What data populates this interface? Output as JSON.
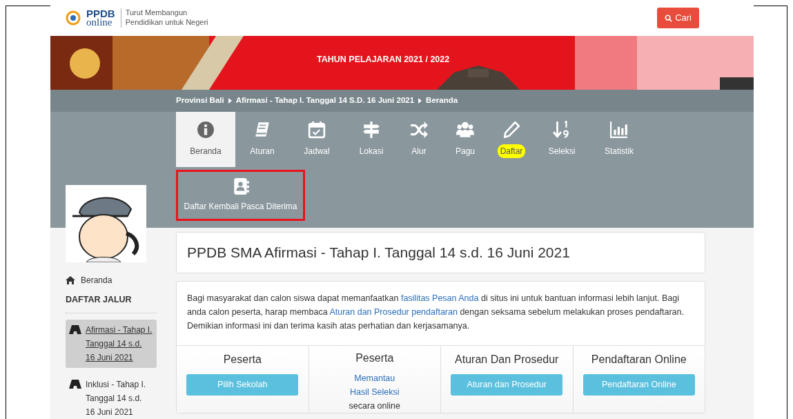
{
  "header": {
    "logo": {
      "top": "PPDB",
      "bottom": "online"
    },
    "tagline": [
      "Turut Membangun",
      "Pendidikan untuk Negeri"
    ],
    "search_button": "Cari"
  },
  "banner": {
    "kind": "picture",
    "title": "TAHUN PELAJARAN 2021 / 2022"
  },
  "breadcrumb": [
    "Provinsi Bali",
    "Afirmasi - Tahap I. Tanggal 14 S.D. 16 Juni 2021",
    "Beranda"
  ],
  "nav": [
    {
      "label": "Beranda",
      "selected": true,
      "marked": false,
      "outlined": false
    },
    {
      "label": "Aturan",
      "selected": false,
      "marked": false,
      "outlined": false
    },
    {
      "label": "Jadwal",
      "selected": false,
      "marked": false,
      "outlined": false
    },
    {
      "label": "Lokasi",
      "selected": false,
      "marked": false,
      "outlined": false
    },
    {
      "label": "Alur",
      "selected": false,
      "marked": false,
      "outlined": false
    },
    {
      "label": "Pagu",
      "selected": false,
      "marked": false,
      "outlined": false
    },
    {
      "label": "Daftar",
      "selected": false,
      "marked": true,
      "outlined": false
    },
    {
      "label": "Seleksi",
      "selected": false,
      "marked": false,
      "outlined": false
    },
    {
      "label": "Statistik",
      "selected": false,
      "marked": false,
      "outlined": false
    },
    {
      "label": "Daftar Kembali Pasca Diterima",
      "selected": false,
      "marked": false,
      "outlined": true
    }
  ],
  "sidebar": {
    "home": "Beranda",
    "heading": "DAFTAR JALUR",
    "items": [
      {
        "label": "Afirmasi - Tahap I. Tanggal 14 s.d. 16 Juni 2021",
        "selected": true
      },
      {
        "label": "Inklusi - Tahap I. Tanggal 14 s.d. 16 Juni 2021",
        "selected": false
      }
    ]
  },
  "page_title": "PPDB SMA Afirmasi - Tahap I. Tanggal 14 s.d. 16 Juni 2021",
  "info": [
    {
      "text": "Bagi masyarakat dan calon siswa dapat memanfaatkan "
    },
    {
      "link": "fasilitas Pesan Anda"
    },
    {
      "text": " di situs ini untuk bantuan informasi lebih lanjut. Bagi anda calon peserta, harap membaca "
    },
    {
      "link": "Aturan dan Prosedur pendaftaran"
    },
    {
      "text": " dengan seksama sebelum melakukan proses pendaftaran. Demikian informasi ini dan terima kasih atas perhatian dan kerjasamanya."
    }
  ],
  "panels": [
    {
      "title": "Peserta",
      "kind": "button",
      "button": "Pilih Sekolah"
    },
    {
      "title": "Peserta",
      "kind": "links",
      "links": [
        "Memantau",
        "Hasil Seleksi"
      ],
      "note": "secara online"
    },
    {
      "title": "Aturan Dan Prosedur",
      "kind": "button",
      "button": "Aturan dan Prosedur"
    },
    {
      "title": "Pendaftaran Online",
      "kind": "button",
      "button": "Pendaftaran Online"
    }
  ]
}
